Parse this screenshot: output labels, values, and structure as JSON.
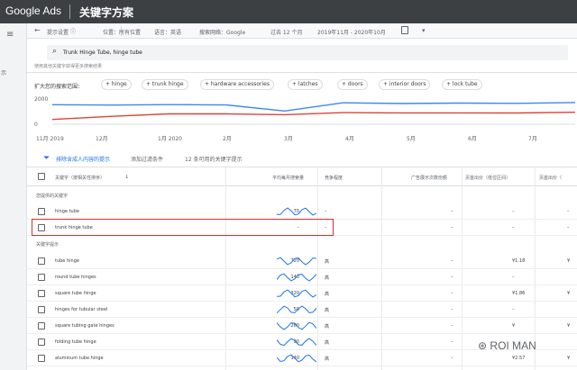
{
  "app": {
    "brand": "Google Ads",
    "page_title": "关键字方案"
  },
  "left_rail": {
    "label": "示"
  },
  "filters": {
    "lang_settings": "提示设置",
    "location": "位置：所有位置",
    "language": "语言：英语",
    "network": "搜索网络：Google",
    "period": "过去 12 个月",
    "date_range": "2019年11月 - 2020年10月"
  },
  "search": {
    "value": "Trunk Hinge Tube, hinge tube"
  },
  "hint": "使用其他关键字获得更多搜索结果",
  "broaden": {
    "label": "扩大您的搜索范围：",
    "chips": [
      "+ hinge",
      "+ trunk hinge",
      "+ hardware accessories",
      "+ latches",
      "+ doors",
      "+ interior doors",
      "+ lock tube"
    ]
  },
  "chart_data": {
    "type": "line",
    "x": [
      "11月 2019",
      "12月",
      "1月 2020",
      "2月",
      "3月",
      "4月",
      "5月",
      "6月",
      "7月"
    ],
    "yticks": [
      2000,
      0
    ],
    "ylim": [
      0,
      2000
    ],
    "series": [
      {
        "color": "#4285f4",
        "values": [
          1550,
          1520,
          1560,
          1530,
          1050,
          1700,
          1640,
          1680,
          1660,
          1720
        ]
      },
      {
        "color": "#db4437",
        "values": [
          380,
          620,
          820,
          820,
          760,
          920,
          900,
          900,
          890,
          950
        ]
      }
    ]
  },
  "toolbar": {
    "filter_label": "排除含成人内容的提示",
    "add_filter": "添加过滤条件",
    "count": "12 条可用的关键字提示"
  },
  "table": {
    "columns": [
      "关键字（按相关性排序）",
      "平均每月搜索量",
      "竞争程度",
      "广告展示次数份额",
      "页首出价（低位区间）",
      "页首出价（"
    ],
    "section_provided": "您提供的关键字",
    "section_ideas": "关键字提示",
    "provided_rows": [
      {
        "keyword": "hinge tube",
        "avg": "70",
        "comp": "–",
        "share": "–",
        "bid_low": "–",
        "bid_high": "–"
      },
      {
        "keyword": "trunk hinge tube",
        "avg": "–",
        "comp": "–",
        "share": "–",
        "bid_low": "–",
        "bid_high": "–"
      }
    ],
    "idea_rows": [
      {
        "keyword": "tube hinge",
        "avg": "720",
        "comp": "高",
        "share": "–",
        "bid_low": "¥1.18",
        "bid_high": "¥"
      },
      {
        "keyword": "round tube hinges",
        "avg": "140",
        "comp": "高",
        "share": "–",
        "bid_low": "–",
        "bid_high": ""
      },
      {
        "keyword": "square tube hinge",
        "avg": "320",
        "comp": "高",
        "share": "–",
        "bid_low": "¥1.86",
        "bid_high": "¥"
      },
      {
        "keyword": "hinges for tubular steel",
        "avg": "50",
        "comp": "高",
        "share": "–",
        "bid_low": "–",
        "bid_high": ""
      },
      {
        "keyword": "square tubing gate hinges",
        "avg": "260",
        "comp": "高",
        "share": "–",
        "bid_low": "¥",
        "bid_high": "¥"
      },
      {
        "keyword": "folding tube hinge",
        "avg": "90",
        "comp": "高",
        "share": "–",
        "bid_low": "–",
        "bid_high": ""
      },
      {
        "keyword": "aluminum tube hinge",
        "avg": "140",
        "comp": "高",
        "share": "–",
        "bid_low": "¥2.57",
        "bid_high": "¥"
      }
    ]
  },
  "watermark": "ROI MAN"
}
